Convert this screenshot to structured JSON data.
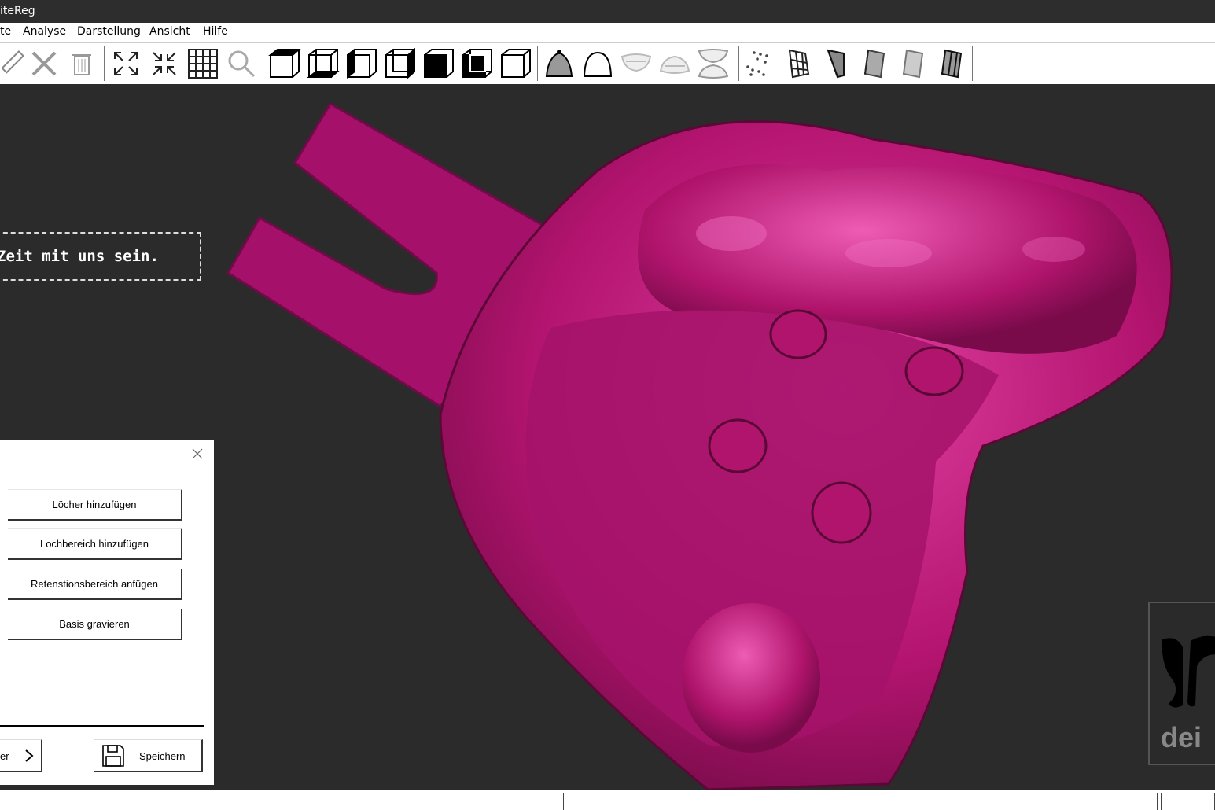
{
  "window": {
    "title": "iteReg"
  },
  "menu": {
    "items": [
      "te",
      "Analyse",
      "Darstellung",
      "Ansicht",
      "Hilfe"
    ]
  },
  "banner": {
    "text": "Zeit mit uns sein."
  },
  "panel": {
    "buttons": [
      "Löcher hinzufügen",
      "Lochbereich hinzufügen",
      "Retenstionsbereich anfügen",
      "Basis gravieren"
    ],
    "nav_label": "er",
    "save_label": "Speichern"
  },
  "logo": {
    "text": "dei e"
  },
  "colors": {
    "model": "#c0187a",
    "viewport_bg": "#2b2b2b",
    "logo_accent": "#d42020"
  }
}
